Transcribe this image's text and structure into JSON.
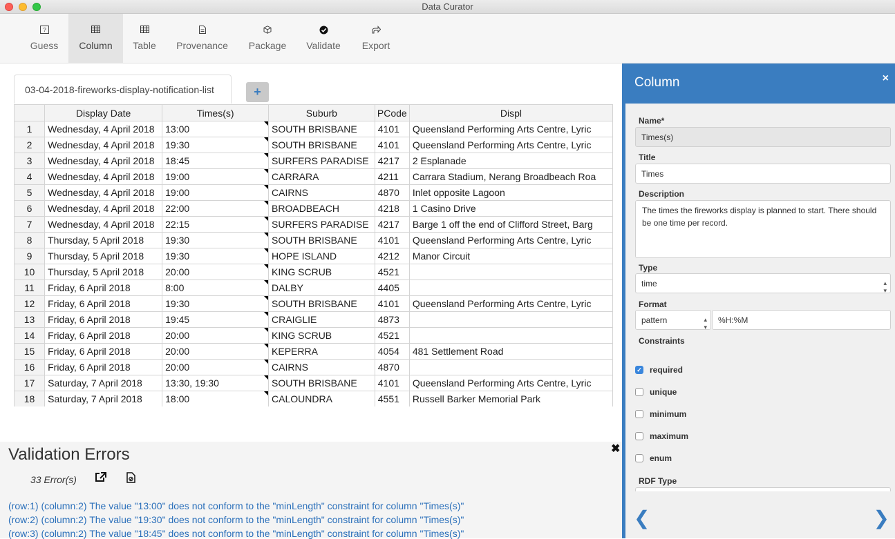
{
  "window": {
    "title": "Data Curator"
  },
  "toolbar": {
    "items": [
      {
        "label": "Guess",
        "icon": "?"
      },
      {
        "label": "Column",
        "icon": "▦"
      },
      {
        "label": "Table",
        "icon": "▦"
      },
      {
        "label": "Provenance",
        "icon": "🗎"
      },
      {
        "label": "Package",
        "icon": "⬡"
      },
      {
        "label": "Validate",
        "icon": "✔"
      },
      {
        "label": "Export",
        "icon": "➦"
      }
    ]
  },
  "tabs": {
    "active": "03-04-2018-fireworks-display-notification-list",
    "add": "+"
  },
  "grid": {
    "headers": [
      "Display Date",
      "Times(s)",
      "Suburb",
      "PCode",
      "Displ"
    ],
    "rows": [
      [
        "1",
        "Wednesday, 4 April 2018",
        "13:00",
        "SOUTH BRISBANE",
        "4101",
        "Queensland Performing Arts Centre, Lyric"
      ],
      [
        "2",
        "Wednesday, 4 April 2018",
        "19:30",
        "SOUTH BRISBANE",
        "4101",
        "Queensland Performing Arts Centre, Lyric"
      ],
      [
        "3",
        "Wednesday, 4 April 2018",
        "18:45",
        "SURFERS PARADISE",
        "4217",
        "2 Esplanade"
      ],
      [
        "4",
        "Wednesday, 4 April 2018",
        "19:00",
        "CARRARA",
        "4211",
        "Carrara Stadium, Nerang Broadbeach Roa"
      ],
      [
        "5",
        "Wednesday, 4 April 2018",
        "19:00",
        "CAIRNS",
        "4870",
        "Inlet opposite Lagoon"
      ],
      [
        "6",
        "Wednesday, 4 April 2018",
        "22:00",
        "BROADBEACH",
        "4218",
        "1 Casino Drive"
      ],
      [
        "7",
        "Wednesday, 4 April 2018",
        "22:15",
        "SURFERS PARADISE",
        "4217",
        "Barge 1 off the end of Clifford Street, Barg"
      ],
      [
        "8",
        "Thursday, 5 April 2018",
        "19:30",
        "SOUTH BRISBANE",
        "4101",
        "Queensland Performing Arts Centre, Lyric"
      ],
      [
        "9",
        "Thursday, 5 April 2018",
        "19:30",
        "HOPE ISLAND",
        "4212",
        "Manor Circuit"
      ],
      [
        "10",
        "Thursday, 5 April 2018",
        "20:00",
        "KING SCRUB",
        "4521",
        ""
      ],
      [
        "11",
        "Friday, 6 April 2018",
        "8:00",
        "DALBY",
        "4405",
        ""
      ],
      [
        "12",
        "Friday, 6 April 2018",
        "19:30",
        "SOUTH BRISBANE",
        "4101",
        "Queensland Performing Arts Centre, Lyric"
      ],
      [
        "13",
        "Friday, 6 April 2018",
        "19:45",
        "CRAIGLIE",
        "4873",
        ""
      ],
      [
        "14",
        "Friday, 6 April 2018",
        "20:00",
        "KING SCRUB",
        "4521",
        ""
      ],
      [
        "15",
        "Friday, 6 April 2018",
        "20:00",
        "KEPERRA",
        "4054",
        "481 Settlement Road"
      ],
      [
        "16",
        "Friday, 6 April 2018",
        "20:00",
        "CAIRNS",
        "4870",
        ""
      ],
      [
        "17",
        "Saturday, 7 April 2018",
        "13:30, 19:30",
        "SOUTH BRISBANE",
        "4101",
        "Queensland Performing Arts Centre, Lyric"
      ],
      [
        "18",
        "Saturday, 7 April 2018",
        "18:00",
        "CALOUNDRA",
        "4551",
        "Russell Barker Memorial Park"
      ]
    ]
  },
  "validation": {
    "title": "Validation Errors",
    "close": "✖",
    "count": "33 Error(s)",
    "errors": [
      "(row:1) (column:2) The value \"13:00\" does not conform to the \"minLength\" constraint for column \"Times(s)\"",
      "(row:2) (column:2) The value \"19:30\" does not conform to the \"minLength\" constraint for column \"Times(s)\"",
      "(row:3) (column:2) The value \"18:45\" does not conform to the \"minLength\" constraint for column \"Times(s)\""
    ]
  },
  "side": {
    "title": "Column",
    "close": "×",
    "name_label": "Name*",
    "name_value": "Times(s)",
    "title_label": "Title",
    "title_value": "Times",
    "desc_label": "Description",
    "desc_value": "The times the fireworks display is planned to start. There should be one time per record.",
    "type_label": "Type",
    "type_value": "time",
    "format_label": "Format",
    "format_select": "pattern",
    "format_value": "%H:%M",
    "constraints_label": "Constraints",
    "constraints": [
      {
        "label": "required",
        "checked": true
      },
      {
        "label": "unique",
        "checked": false
      },
      {
        "label": "minimum",
        "checked": false
      },
      {
        "label": "maximum",
        "checked": false
      },
      {
        "label": "enum",
        "checked": false
      }
    ],
    "rdf_label": "RDF Type",
    "prev": "❮",
    "next": "❯"
  },
  "colors": {
    "accent": "#3a7dc0",
    "error_text": "#2a6fba"
  }
}
